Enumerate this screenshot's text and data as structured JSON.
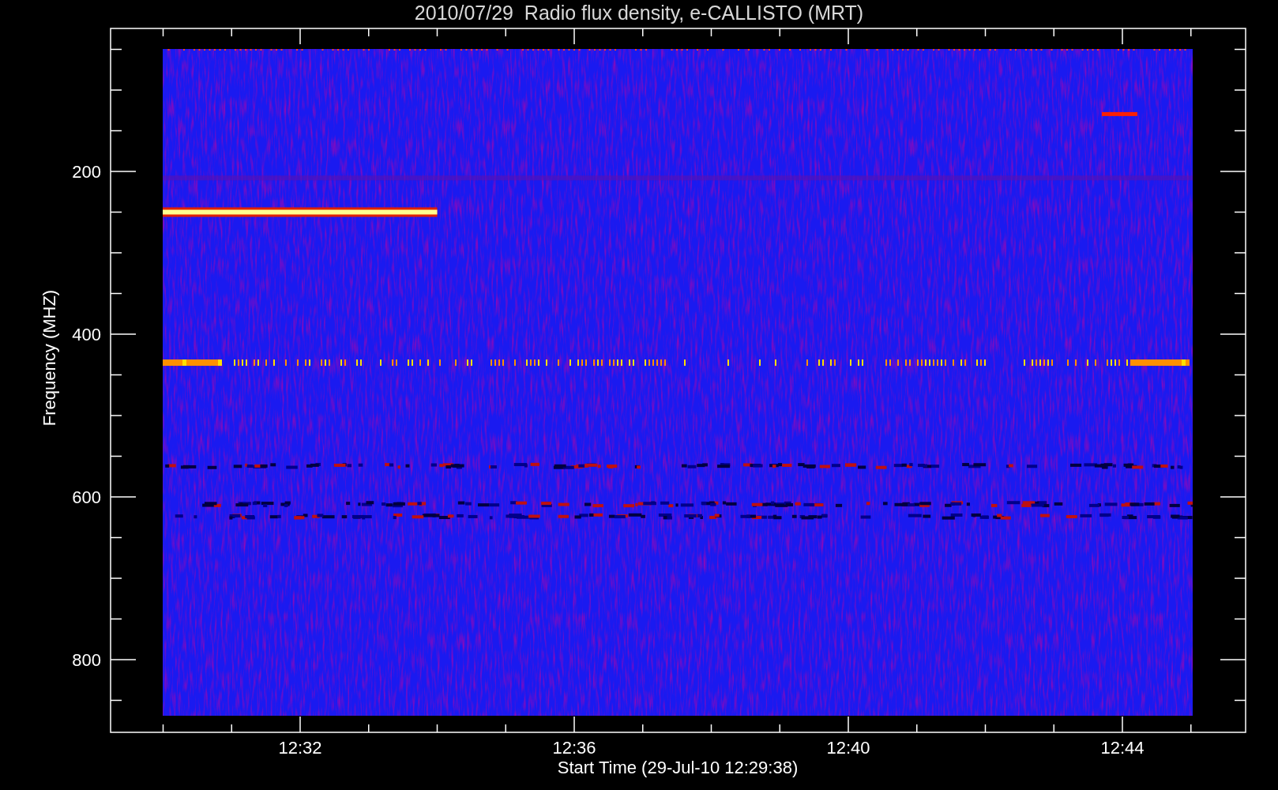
{
  "title": "2010/07/29  Radio flux density, e-CALLISTO (MRT)",
  "y_axis": {
    "label": "Frequency (MHZ)",
    "ticks": [
      "200",
      "400",
      "600",
      "800"
    ]
  },
  "x_axis": {
    "label": "Start Time (29-Jul-10 12:29:38)",
    "ticks": [
      "12:32",
      "12:36",
      "12:40",
      "12:44"
    ]
  }
}
